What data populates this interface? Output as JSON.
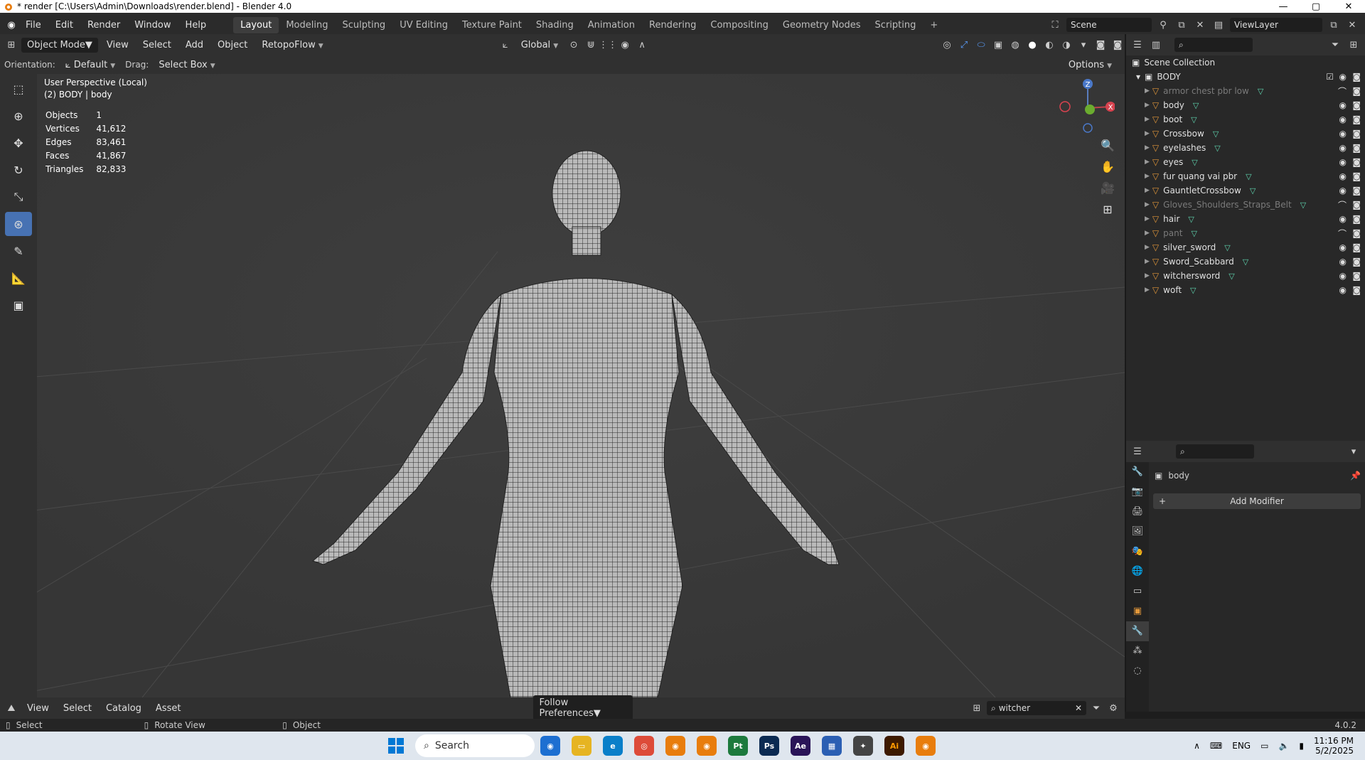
{
  "window": {
    "title": "* render [C:\\Users\\Admin\\Downloads\\render.blend] - Blender 4.0"
  },
  "menu": [
    "File",
    "Edit",
    "Render",
    "Window",
    "Help"
  ],
  "workspaces": [
    "Layout",
    "Modeling",
    "Sculpting",
    "UV Editing",
    "Texture Paint",
    "Shading",
    "Animation",
    "Rendering",
    "Compositing",
    "Geometry Nodes",
    "Scripting"
  ],
  "scene": {
    "name": "Scene",
    "view_layer": "ViewLayer"
  },
  "viewport_header": {
    "mode": "Object Mode",
    "view": "View",
    "select": "Select",
    "add": "Add",
    "object": "Object",
    "addon": "RetopoFlow",
    "transform": "Global",
    "options": "Options"
  },
  "tool_settings": {
    "orientation_label": "Orientation:",
    "orientation": "Default",
    "drag_label": "Drag:",
    "drag": "Select Box"
  },
  "overlay": {
    "view": "User Perspective (Local)",
    "object": "(2) BODY | body"
  },
  "stats": [
    {
      "label": "Objects",
      "value": "1"
    },
    {
      "label": "Vertices",
      "value": "41,612"
    },
    {
      "label": "Edges",
      "value": "83,461"
    },
    {
      "label": "Faces",
      "value": "41,867"
    },
    {
      "label": "Triangles",
      "value": "82,833"
    }
  ],
  "gizmo": {
    "x": "X",
    "z": "Z"
  },
  "outliner": {
    "root": "Scene Collection",
    "collection": "BODY",
    "items": [
      {
        "name": "armor chest pbr low",
        "dim": true
      },
      {
        "name": "body",
        "dim": false
      },
      {
        "name": "boot",
        "dim": false
      },
      {
        "name": "Crossbow",
        "dim": false
      },
      {
        "name": "eyelashes",
        "dim": false
      },
      {
        "name": "eyes",
        "dim": false
      },
      {
        "name": "fur quang vai pbr",
        "dim": false
      },
      {
        "name": "GauntletCrossbow",
        "dim": false
      },
      {
        "name": "Gloves_Shoulders_Straps_Belt",
        "dim": true
      },
      {
        "name": "hair",
        "dim": false
      },
      {
        "name": "pant",
        "dim": true
      },
      {
        "name": "silver_sword",
        "dim": false
      },
      {
        "name": "Sword_Scabbard",
        "dim": false
      },
      {
        "name": "witchersword",
        "dim": false
      },
      {
        "name": "woft",
        "dim": false
      }
    ]
  },
  "properties": {
    "object": "body",
    "add_modifier": "Add Modifier"
  },
  "asset_browser": {
    "view": "View",
    "select": "Select",
    "catalog": "Catalog",
    "asset": "Asset",
    "import": "Follow Preferences",
    "search": "witcher"
  },
  "status": {
    "select": "Select",
    "rotate": "Rotate View",
    "object": "Object",
    "version": "4.0.2"
  },
  "taskbar": {
    "search": "Search",
    "lang": "ENG",
    "time": "11:16 PM",
    "date": "5/2/2025",
    "apps": [
      {
        "id": "pt",
        "label": "Pt",
        "color": "#1d7a3d"
      },
      {
        "id": "ps",
        "label": "Ps",
        "color": "#0b2a52"
      },
      {
        "id": "ae",
        "label": "Ae",
        "color": "#2a1458"
      },
      {
        "id": "ai",
        "label": "Ai",
        "color": "#3d1a00"
      }
    ]
  },
  "colors": {
    "accent": "#4772b3",
    "header": "#303030",
    "viewport": "#393939",
    "mesh_icon": "#5fd6b0",
    "object_icon": "#e0963a"
  }
}
